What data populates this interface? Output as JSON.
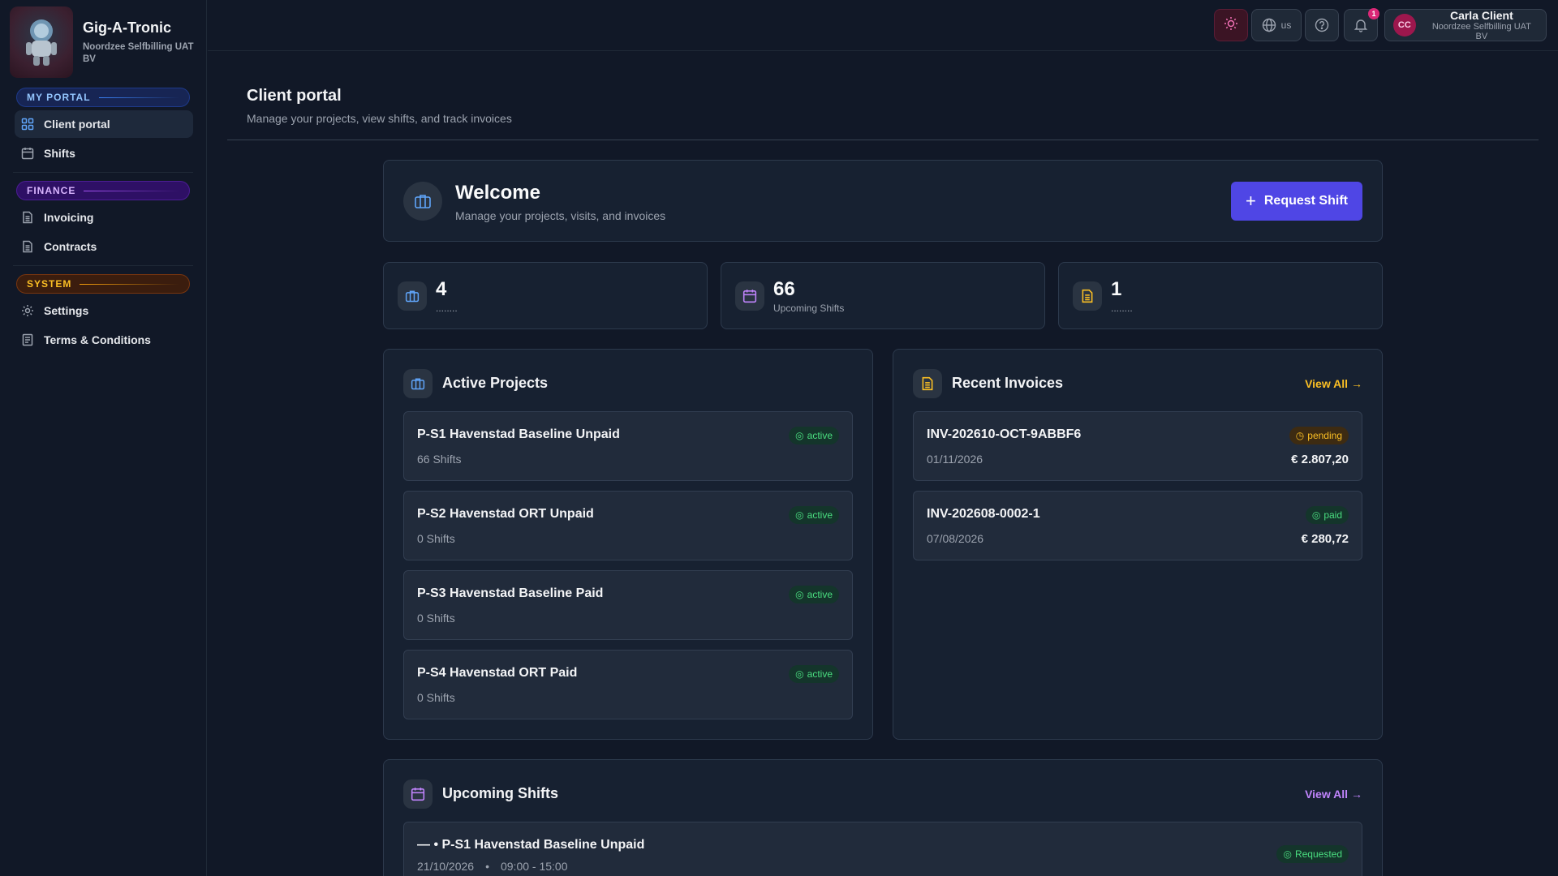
{
  "brand": {
    "name": "Gig-A-Tronic",
    "org": "Noordzee Selfbilling UAT BV"
  },
  "sidebar": {
    "sections": [
      {
        "label": "MY PORTAL",
        "items": [
          {
            "label": "Client portal",
            "icon": "grid-icon"
          },
          {
            "label": "Shifts",
            "icon": "calendar-icon"
          }
        ]
      },
      {
        "label": "FINANCE",
        "items": [
          {
            "label": "Invoicing",
            "icon": "document-icon"
          },
          {
            "label": "Contracts",
            "icon": "document-icon"
          }
        ]
      },
      {
        "label": "SYSTEM",
        "items": [
          {
            "label": "Settings",
            "icon": "gear-icon"
          },
          {
            "label": "Terms & Conditions",
            "icon": "scroll-icon"
          }
        ]
      }
    ]
  },
  "topbar": {
    "language": "us",
    "notifications_count": "1",
    "user": {
      "initials": "CC",
      "name": "Carla Client",
      "org": "Noordzee Selfbilling UAT BV"
    }
  },
  "page": {
    "title": "Client portal",
    "subtitle": "Manage your projects, view shifts, and track invoices"
  },
  "welcome": {
    "title": "Welcome",
    "subtitle": "Manage your projects, visits, and invoices",
    "button": "Request Shift"
  },
  "stats": [
    {
      "value": "4",
      "label": "........"
    },
    {
      "value": "66",
      "label": "Upcoming Shifts"
    },
    {
      "value": "1",
      "label": "........"
    }
  ],
  "projects": {
    "title": "Active Projects",
    "items": [
      {
        "name": "P-S1 Havenstad Baseline Unpaid",
        "shifts": "66 Shifts",
        "status": "active"
      },
      {
        "name": "P-S2 Havenstad ORT Unpaid",
        "shifts": "0 Shifts",
        "status": "active"
      },
      {
        "name": "P-S3 Havenstad Baseline Paid",
        "shifts": "0 Shifts",
        "status": "active"
      },
      {
        "name": "P-S4 Havenstad ORT Paid",
        "shifts": "0 Shifts",
        "status": "active"
      }
    ]
  },
  "invoices": {
    "title": "Recent Invoices",
    "view_all": "View All",
    "items": [
      {
        "number": "INV-202610-OCT-9ABBF6",
        "date": "01/11/2026",
        "amount": "€ 2.807,20",
        "status": "pending"
      },
      {
        "number": "INV-202608-0002-1",
        "date": "07/08/2026",
        "amount": "€ 280,72",
        "status": "paid"
      }
    ]
  },
  "shifts": {
    "title": "Upcoming Shifts",
    "view_all": "View All",
    "items": [
      {
        "name": "— • P-S1 Havenstad Baseline Unpaid",
        "date": "21/10/2026",
        "sep": "•",
        "time": "09:00 - 15:00",
        "status": "Requested"
      }
    ]
  },
  "colors": {
    "accent": "#4f46e5",
    "blue": "#60a5fa",
    "purple": "#c084fc",
    "amber": "#fbbf24",
    "green": "#4ade80"
  }
}
